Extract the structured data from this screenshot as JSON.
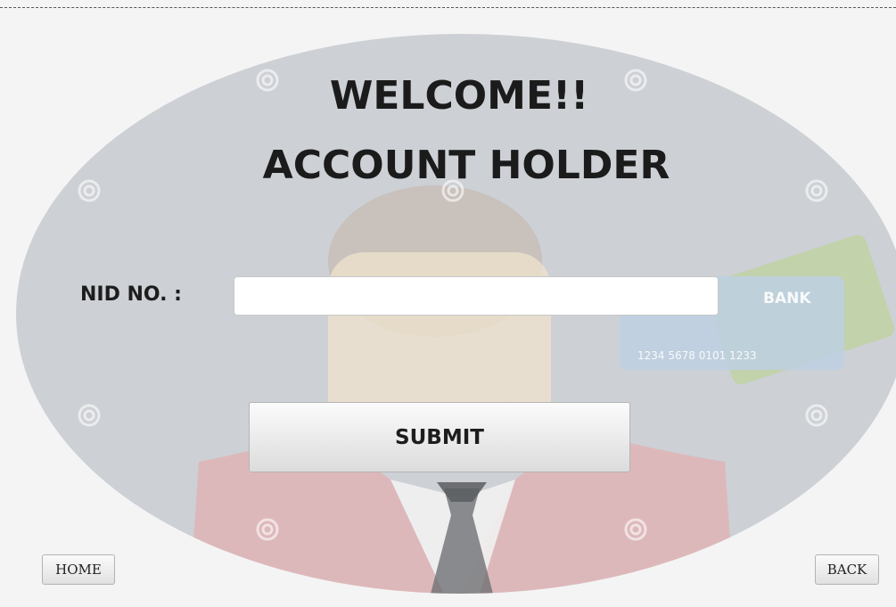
{
  "header": {
    "title_line1": "WELCOME!!",
    "title_line2": "ACCOUNT HOLDER"
  },
  "form": {
    "nid_label": "NID NO. :",
    "nid_value": "",
    "submit_label": "SUBMIT"
  },
  "nav": {
    "home_label": "HOME",
    "back_label": "BACK"
  },
  "background": {
    "card_brand": "BANK",
    "card_number": "1234 5678 0101 1233"
  },
  "colors": {
    "oval": "#cdd0d5",
    "page": "#f4f4f4",
    "title_text": "#1b1b1b"
  }
}
